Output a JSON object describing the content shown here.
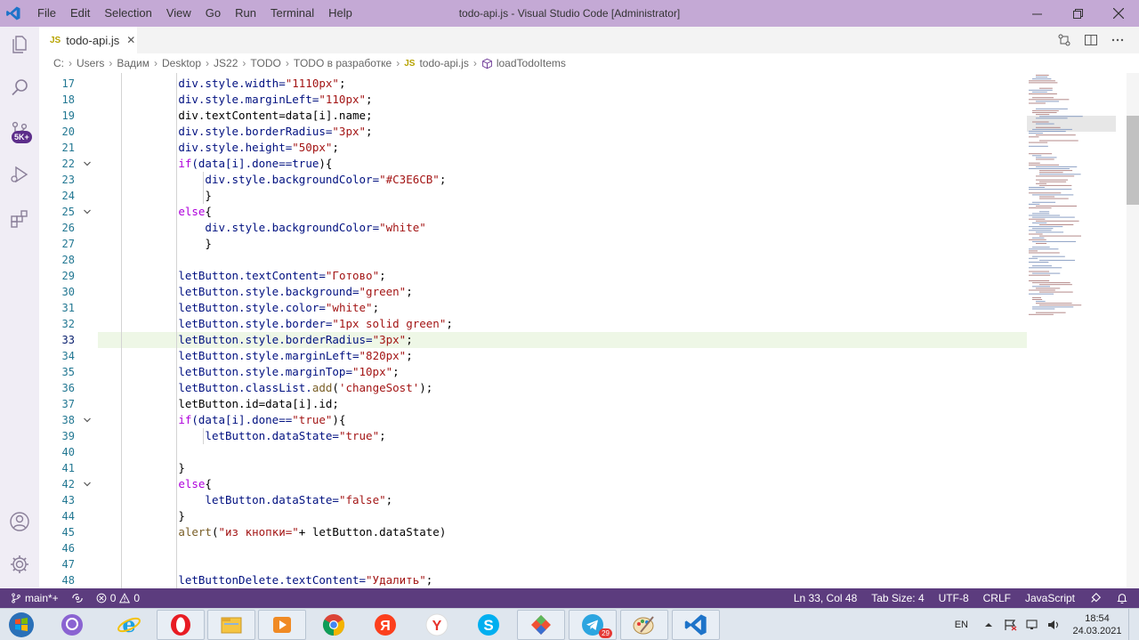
{
  "titlebar": {
    "title": "todo-api.js - Visual Studio Code [Administrator]",
    "menu": [
      "File",
      "Edit",
      "Selection",
      "View",
      "Go",
      "Run",
      "Terminal",
      "Help"
    ]
  },
  "activity": {
    "scm_badge": "5K+"
  },
  "tab": {
    "icon": "JS",
    "label": "todo-api.js",
    "close": "✕"
  },
  "breadcrumb": {
    "items": [
      "C:",
      "Users",
      "Вадим",
      "Desktop",
      "JS22",
      "TODO",
      "TODO в разработке"
    ],
    "file_icon": "JS",
    "file": "todo-api.js",
    "symbol": "loadTodoItems"
  },
  "editor": {
    "current_line": 33,
    "lines": [
      {
        "n": 17,
        "indent": 8,
        "tokens": [
          [
            "div.style.width=",
            "p"
          ],
          [
            "\"1110px\"",
            "s"
          ],
          [
            ";",
            "x"
          ]
        ]
      },
      {
        "n": 18,
        "indent": 8,
        "tokens": [
          [
            "div.style.marginLeft=",
            "p"
          ],
          [
            "\"110px\"",
            "s"
          ],
          [
            ";",
            "x"
          ]
        ]
      },
      {
        "n": 19,
        "indent": 8,
        "tokens": [
          [
            "div.textContent=data[i].name",
            ""
          ],
          [
            ";",
            "x"
          ]
        ]
      },
      {
        "n": 20,
        "indent": 8,
        "tokens": [
          [
            "div.style.borderRadius=",
            "p"
          ],
          [
            "\"3px\"",
            "s"
          ],
          [
            ";",
            "x"
          ]
        ]
      },
      {
        "n": 21,
        "indent": 8,
        "tokens": [
          [
            "div.style.height=",
            "p"
          ],
          [
            "\"50px\"",
            "s"
          ],
          [
            ";",
            "x"
          ]
        ]
      },
      {
        "n": 22,
        "indent": 8,
        "fold": true,
        "tokens": [
          [
            "if",
            "k"
          ],
          [
            "(data[i].done==",
            "p"
          ],
          [
            "true",
            "b"
          ],
          [
            "){",
            "x"
          ]
        ]
      },
      {
        "n": 23,
        "indent": 12,
        "tokens": [
          [
            "div.style.backgroundColor=",
            "p"
          ],
          [
            "\"#C3E6CB\"",
            "s"
          ],
          [
            ";",
            "x"
          ]
        ]
      },
      {
        "n": 24,
        "indent": 12,
        "tokens": [
          [
            "}",
            "x"
          ]
        ]
      },
      {
        "n": 25,
        "indent": 8,
        "fold": true,
        "tokens": [
          [
            "else",
            "k"
          ],
          [
            "{",
            "x"
          ]
        ]
      },
      {
        "n": 26,
        "indent": 12,
        "tokens": [
          [
            "div.style.backgroundColor=",
            "p"
          ],
          [
            "\"white\"",
            "s"
          ]
        ]
      },
      {
        "n": 27,
        "indent": 12,
        "tokens": [
          [
            "}",
            "x"
          ]
        ]
      },
      {
        "n": 28,
        "indent": 0,
        "tokens": []
      },
      {
        "n": 29,
        "indent": 8,
        "tokens": [
          [
            "letButton.textContent=",
            "p"
          ],
          [
            "\"Готово\"",
            "s"
          ],
          [
            ";",
            "x"
          ]
        ]
      },
      {
        "n": 30,
        "indent": 8,
        "tokens": [
          [
            "letButton.style.background=",
            "p"
          ],
          [
            "\"green\"",
            "s"
          ],
          [
            ";",
            "x"
          ]
        ]
      },
      {
        "n": 31,
        "indent": 8,
        "tokens": [
          [
            "letButton.style.color=",
            "p"
          ],
          [
            "\"white\"",
            "s"
          ],
          [
            ";",
            "x"
          ]
        ]
      },
      {
        "n": 32,
        "indent": 8,
        "tokens": [
          [
            "letButton.style.border=",
            "p"
          ],
          [
            "\"1px solid green\"",
            "s"
          ],
          [
            ";",
            "x"
          ]
        ]
      },
      {
        "n": 33,
        "indent": 8,
        "tokens": [
          [
            "letButton.style.borderRadius=",
            "p"
          ],
          [
            "\"3px\"",
            "s"
          ],
          [
            ";",
            "x"
          ]
        ]
      },
      {
        "n": 34,
        "indent": 8,
        "tokens": [
          [
            "letButton.style.marginLeft=",
            "p"
          ],
          [
            "\"820px\"",
            "s"
          ],
          [
            ";",
            "x"
          ]
        ]
      },
      {
        "n": 35,
        "indent": 8,
        "tokens": [
          [
            "letButton.style.marginTop=",
            "p"
          ],
          [
            "\"10px\"",
            "s"
          ],
          [
            ";",
            "x"
          ]
        ]
      },
      {
        "n": 36,
        "indent": 8,
        "tokens": [
          [
            "letButton.classList.",
            "p"
          ],
          [
            "add",
            "f"
          ],
          [
            "(",
            "x"
          ],
          [
            "'changeSost'",
            "s"
          ],
          [
            ");",
            "x"
          ]
        ]
      },
      {
        "n": 37,
        "indent": 8,
        "tokens": [
          [
            "letButton.id=data[i].id",
            ""
          ],
          [
            ";",
            "x"
          ]
        ]
      },
      {
        "n": 38,
        "indent": 8,
        "fold": true,
        "tokens": [
          [
            "if",
            "k"
          ],
          [
            "(data[i].done==",
            "p"
          ],
          [
            "\"true\"",
            "s"
          ],
          [
            "){",
            "x"
          ]
        ]
      },
      {
        "n": 39,
        "indent": 12,
        "tokens": [
          [
            "letButton.dataState=",
            "p"
          ],
          [
            "\"true\"",
            "s"
          ],
          [
            ";",
            "x"
          ]
        ]
      },
      {
        "n": 40,
        "indent": 0,
        "tokens": []
      },
      {
        "n": 41,
        "indent": 8,
        "tokens": [
          [
            "}",
            "x"
          ]
        ]
      },
      {
        "n": 42,
        "indent": 8,
        "fold": true,
        "tokens": [
          [
            "else",
            "k"
          ],
          [
            "{",
            "x"
          ]
        ]
      },
      {
        "n": 43,
        "indent": 12,
        "tokens": [
          [
            "letButton.dataState=",
            "p"
          ],
          [
            "\"false\"",
            "s"
          ],
          [
            ";",
            "x"
          ]
        ]
      },
      {
        "n": 44,
        "indent": 8,
        "tokens": [
          [
            "}",
            "x"
          ]
        ]
      },
      {
        "n": 45,
        "indent": 8,
        "tokens": [
          [
            "alert",
            "f"
          ],
          [
            "(",
            "x"
          ],
          [
            "\"из кнопки=\"",
            "s"
          ],
          [
            "+ letButton.dataState)",
            "x"
          ]
        ]
      },
      {
        "n": 46,
        "indent": 0,
        "tokens": []
      },
      {
        "n": 47,
        "indent": 0,
        "tokens": []
      },
      {
        "n": 48,
        "indent": 8,
        "tokens": [
          [
            "letButtonDelete.textContent=",
            "p"
          ],
          [
            "\"Удалить\"",
            "s"
          ],
          [
            ";",
            "x"
          ]
        ]
      }
    ]
  },
  "statusbar": {
    "branch": "main*+",
    "errors": "0",
    "warnings": "0",
    "position": "Ln 33, Col 48",
    "tab_size": "Tab Size: 4",
    "encoding": "UTF-8",
    "eol": "CRLF",
    "language": "JavaScript"
  },
  "taskbar": {
    "lang": "EN",
    "time": "18:54",
    "date": "24.03.2021",
    "telegram_badge": "29",
    "apps": [
      "viber-icon",
      "ie-icon",
      "opera-icon",
      "explorer-icon",
      "media-player-icon",
      "chrome-icon",
      "yandex-icon",
      "yandex-browser-icon",
      "skype-icon",
      "git-icon",
      "telegram-icon",
      "paint-icon",
      "vscode-icon"
    ]
  },
  "colors": {
    "titlebar": "#c4a9d5",
    "statusbar": "#5c3c7e",
    "string": "#a31515",
    "property": "#001080",
    "keyword": "#af00db",
    "function": "#795e26",
    "line_number": "#237893"
  }
}
